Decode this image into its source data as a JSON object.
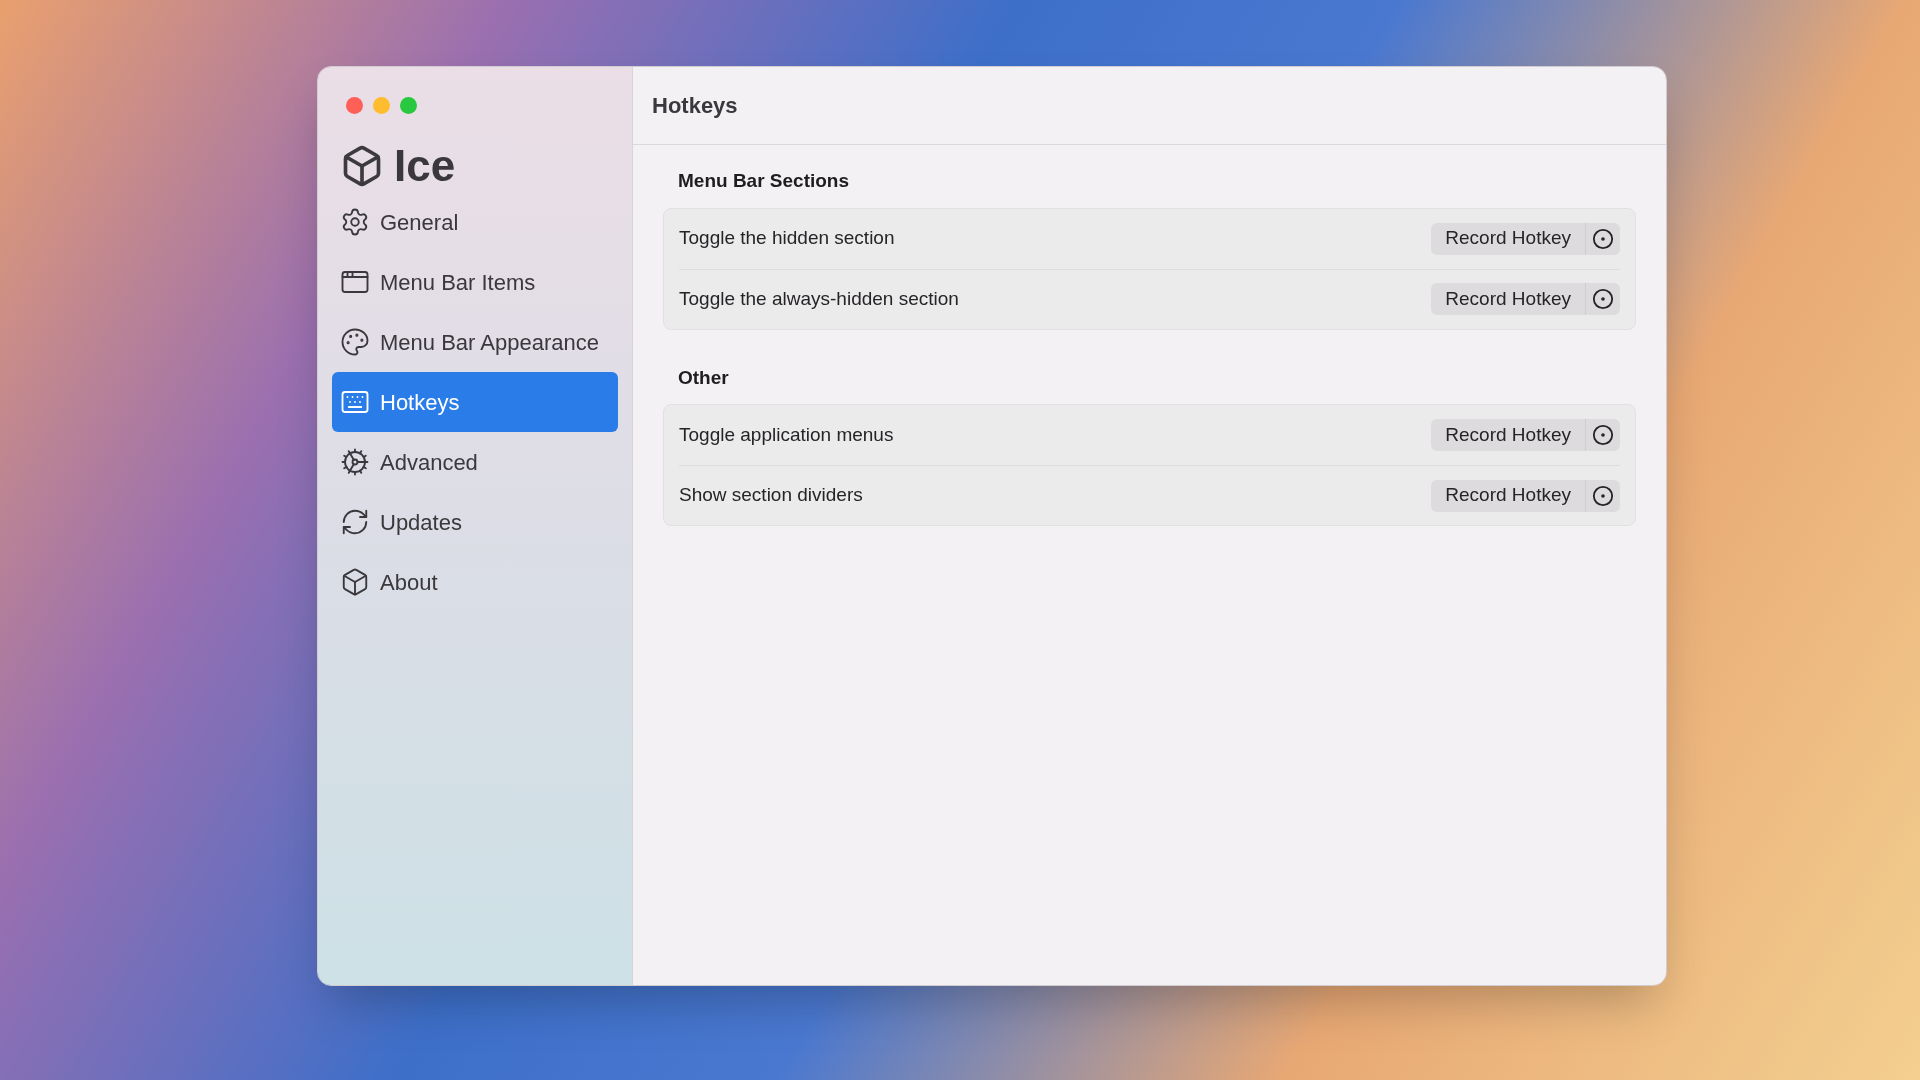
{
  "app": {
    "name": "Ice"
  },
  "sidebar": {
    "items": [
      {
        "label": "General",
        "selected": false
      },
      {
        "label": "Menu Bar Items",
        "selected": false
      },
      {
        "label": "Menu Bar Appearance",
        "selected": false
      },
      {
        "label": "Hotkeys",
        "selected": true
      },
      {
        "label": "Advanced",
        "selected": false
      },
      {
        "label": "Updates",
        "selected": false
      },
      {
        "label": "About",
        "selected": false
      }
    ]
  },
  "content": {
    "title": "Hotkeys",
    "sections": [
      {
        "title": "Menu Bar Sections",
        "rows": [
          {
            "label": "Toggle the hidden section",
            "button": "Record Hotkey"
          },
          {
            "label": "Toggle the always-hidden section",
            "button": "Record Hotkey"
          }
        ]
      },
      {
        "title": "Other",
        "rows": [
          {
            "label": "Toggle application menus",
            "button": "Record Hotkey"
          },
          {
            "label": "Show section dividers",
            "button": "Record Hotkey"
          }
        ]
      }
    ]
  }
}
